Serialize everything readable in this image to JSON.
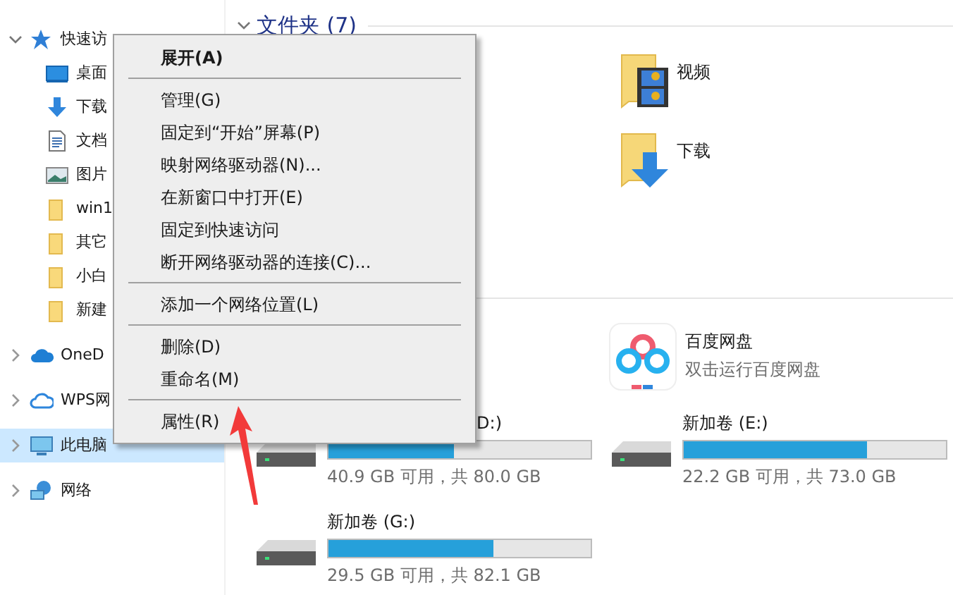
{
  "sidebar": {
    "items": [
      {
        "label": "快速访",
        "kind": "star",
        "expanded": true,
        "selected": false,
        "children": [
          {
            "label": "桌面",
            "kind": "desktop"
          },
          {
            "label": "下载",
            "kind": "download"
          },
          {
            "label": "文档",
            "kind": "document"
          },
          {
            "label": "图片",
            "kind": "image"
          },
          {
            "label": "win1",
            "kind": "folder"
          },
          {
            "label": "其它",
            "kind": "folder"
          },
          {
            "label": "小白",
            "kind": "folder"
          },
          {
            "label": "新建",
            "kind": "folder"
          }
        ]
      },
      {
        "label": "OneD",
        "kind": "cloud",
        "expanded": false,
        "selected": false
      },
      {
        "label": "WPS网",
        "kind": "outline",
        "expanded": false,
        "selected": false
      },
      {
        "label": "此电脑",
        "kind": "computer",
        "expanded": false,
        "selected": true
      },
      {
        "label": "网络",
        "kind": "network",
        "expanded": false,
        "selected": false
      }
    ]
  },
  "folders": {
    "title": "文件夹 (7)",
    "items": [
      {
        "label": "视频",
        "kind": "video"
      },
      {
        "label": "下载",
        "kind": "download"
      }
    ]
  },
  "app": {
    "name": "百度网盘",
    "subtitle": "双击运行百度网盘"
  },
  "drives": [
    {
      "label": "D:)",
      "level": 0.48,
      "reading": "40.9 GB 可用，共 80.0 GB"
    },
    {
      "label": "新加卷 (E:)",
      "level": 0.7,
      "reading": "22.2 GB 可用，共 73.0 GB"
    },
    {
      "label": "新加卷 (G:)",
      "level": 0.63,
      "reading": "29.5 GB 可用，共 82.1 GB"
    }
  ],
  "context_menu": {
    "items": [
      {
        "kind": "item",
        "label": "展开(A)",
        "default": true
      },
      {
        "kind": "separator"
      },
      {
        "kind": "item",
        "label": "管理(G)",
        "default": false
      },
      {
        "kind": "item",
        "label": "固定到“开始”屏幕(P)",
        "default": false
      },
      {
        "kind": "item",
        "label": "映射网络驱动器(N)...",
        "default": false
      },
      {
        "kind": "item",
        "label": "在新窗口中打开(E)",
        "default": false
      },
      {
        "kind": "item",
        "label": "固定到快速访问",
        "default": false
      },
      {
        "kind": "item",
        "label": "断开网络驱动器的连接(C)...",
        "default": false
      },
      {
        "kind": "separator"
      },
      {
        "kind": "item",
        "label": "添加一个网络位置(L)",
        "default": false
      },
      {
        "kind": "separator"
      },
      {
        "kind": "item",
        "label": "删除(D)",
        "default": false
      },
      {
        "kind": "item",
        "label": "重命名(M)",
        "default": false
      },
      {
        "kind": "separator"
      },
      {
        "kind": "item",
        "label": "属性(R)",
        "default": false
      }
    ]
  }
}
